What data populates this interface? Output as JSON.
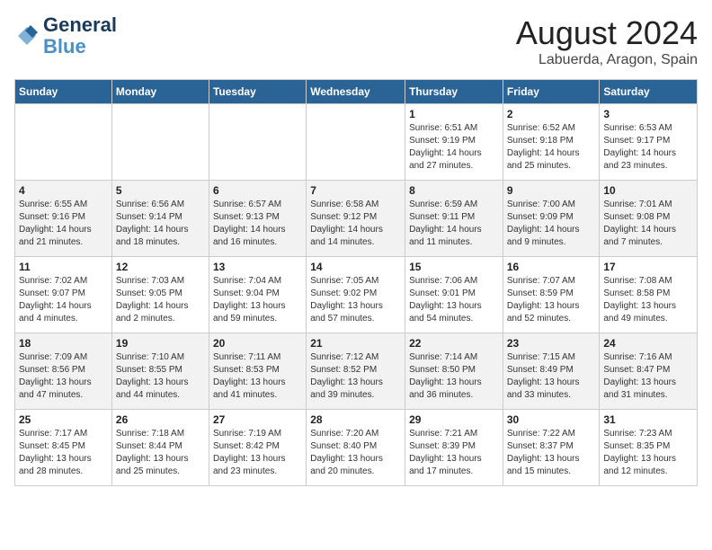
{
  "header": {
    "logo_line1": "General",
    "logo_line2": "Blue",
    "month": "August 2024",
    "location": "Labuerda, Aragon, Spain"
  },
  "weekdays": [
    "Sunday",
    "Monday",
    "Tuesday",
    "Wednesday",
    "Thursday",
    "Friday",
    "Saturday"
  ],
  "weeks": [
    [
      {
        "day": "",
        "info": ""
      },
      {
        "day": "",
        "info": ""
      },
      {
        "day": "",
        "info": ""
      },
      {
        "day": "",
        "info": ""
      },
      {
        "day": "1",
        "info": "Sunrise: 6:51 AM\nSunset: 9:19 PM\nDaylight: 14 hours\nand 27 minutes."
      },
      {
        "day": "2",
        "info": "Sunrise: 6:52 AM\nSunset: 9:18 PM\nDaylight: 14 hours\nand 25 minutes."
      },
      {
        "day": "3",
        "info": "Sunrise: 6:53 AM\nSunset: 9:17 PM\nDaylight: 14 hours\nand 23 minutes."
      }
    ],
    [
      {
        "day": "4",
        "info": "Sunrise: 6:55 AM\nSunset: 9:16 PM\nDaylight: 14 hours\nand 21 minutes."
      },
      {
        "day": "5",
        "info": "Sunrise: 6:56 AM\nSunset: 9:14 PM\nDaylight: 14 hours\nand 18 minutes."
      },
      {
        "day": "6",
        "info": "Sunrise: 6:57 AM\nSunset: 9:13 PM\nDaylight: 14 hours\nand 16 minutes."
      },
      {
        "day": "7",
        "info": "Sunrise: 6:58 AM\nSunset: 9:12 PM\nDaylight: 14 hours\nand 14 minutes."
      },
      {
        "day": "8",
        "info": "Sunrise: 6:59 AM\nSunset: 9:11 PM\nDaylight: 14 hours\nand 11 minutes."
      },
      {
        "day": "9",
        "info": "Sunrise: 7:00 AM\nSunset: 9:09 PM\nDaylight: 14 hours\nand 9 minutes."
      },
      {
        "day": "10",
        "info": "Sunrise: 7:01 AM\nSunset: 9:08 PM\nDaylight: 14 hours\nand 7 minutes."
      }
    ],
    [
      {
        "day": "11",
        "info": "Sunrise: 7:02 AM\nSunset: 9:07 PM\nDaylight: 14 hours\nand 4 minutes."
      },
      {
        "day": "12",
        "info": "Sunrise: 7:03 AM\nSunset: 9:05 PM\nDaylight: 14 hours\nand 2 minutes."
      },
      {
        "day": "13",
        "info": "Sunrise: 7:04 AM\nSunset: 9:04 PM\nDaylight: 13 hours\nand 59 minutes."
      },
      {
        "day": "14",
        "info": "Sunrise: 7:05 AM\nSunset: 9:02 PM\nDaylight: 13 hours\nand 57 minutes."
      },
      {
        "day": "15",
        "info": "Sunrise: 7:06 AM\nSunset: 9:01 PM\nDaylight: 13 hours\nand 54 minutes."
      },
      {
        "day": "16",
        "info": "Sunrise: 7:07 AM\nSunset: 8:59 PM\nDaylight: 13 hours\nand 52 minutes."
      },
      {
        "day": "17",
        "info": "Sunrise: 7:08 AM\nSunset: 8:58 PM\nDaylight: 13 hours\nand 49 minutes."
      }
    ],
    [
      {
        "day": "18",
        "info": "Sunrise: 7:09 AM\nSunset: 8:56 PM\nDaylight: 13 hours\nand 47 minutes."
      },
      {
        "day": "19",
        "info": "Sunrise: 7:10 AM\nSunset: 8:55 PM\nDaylight: 13 hours\nand 44 minutes."
      },
      {
        "day": "20",
        "info": "Sunrise: 7:11 AM\nSunset: 8:53 PM\nDaylight: 13 hours\nand 41 minutes."
      },
      {
        "day": "21",
        "info": "Sunrise: 7:12 AM\nSunset: 8:52 PM\nDaylight: 13 hours\nand 39 minutes."
      },
      {
        "day": "22",
        "info": "Sunrise: 7:14 AM\nSunset: 8:50 PM\nDaylight: 13 hours\nand 36 minutes."
      },
      {
        "day": "23",
        "info": "Sunrise: 7:15 AM\nSunset: 8:49 PM\nDaylight: 13 hours\nand 33 minutes."
      },
      {
        "day": "24",
        "info": "Sunrise: 7:16 AM\nSunset: 8:47 PM\nDaylight: 13 hours\nand 31 minutes."
      }
    ],
    [
      {
        "day": "25",
        "info": "Sunrise: 7:17 AM\nSunset: 8:45 PM\nDaylight: 13 hours\nand 28 minutes."
      },
      {
        "day": "26",
        "info": "Sunrise: 7:18 AM\nSunset: 8:44 PM\nDaylight: 13 hours\nand 25 minutes."
      },
      {
        "day": "27",
        "info": "Sunrise: 7:19 AM\nSunset: 8:42 PM\nDaylight: 13 hours\nand 23 minutes."
      },
      {
        "day": "28",
        "info": "Sunrise: 7:20 AM\nSunset: 8:40 PM\nDaylight: 13 hours\nand 20 minutes."
      },
      {
        "day": "29",
        "info": "Sunrise: 7:21 AM\nSunset: 8:39 PM\nDaylight: 13 hours\nand 17 minutes."
      },
      {
        "day": "30",
        "info": "Sunrise: 7:22 AM\nSunset: 8:37 PM\nDaylight: 13 hours\nand 15 minutes."
      },
      {
        "day": "31",
        "info": "Sunrise: 7:23 AM\nSunset: 8:35 PM\nDaylight: 13 hours\nand 12 minutes."
      }
    ]
  ]
}
